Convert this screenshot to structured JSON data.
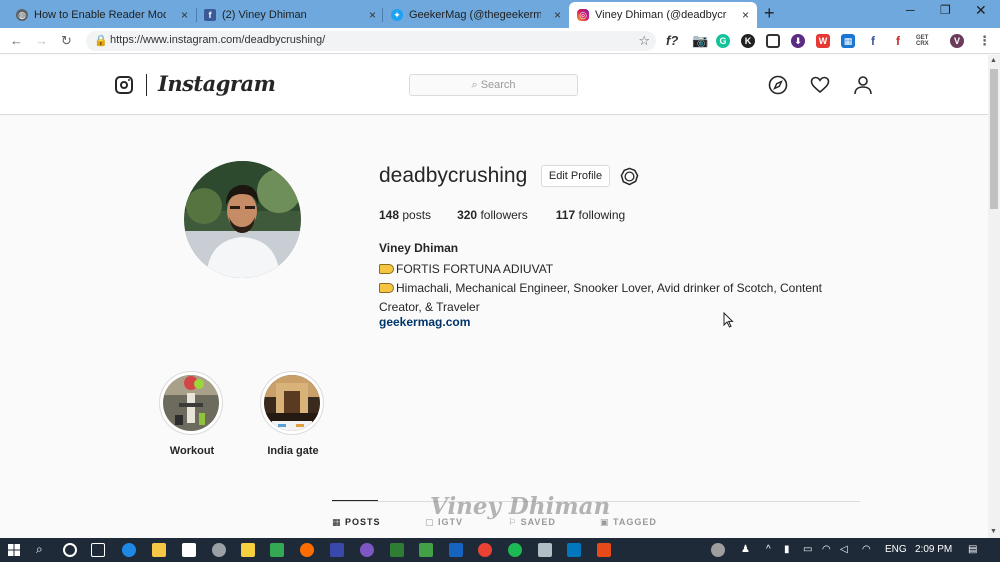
{
  "browser": {
    "tabs": [
      {
        "title": "How to Enable Reader Mode in C",
        "icon": "globe-icon"
      },
      {
        "title": "(2) Viney Dhiman",
        "icon": "facebook-icon"
      },
      {
        "title": "GeekerMag (@thegeekermag) | T",
        "icon": "twitter-icon"
      },
      {
        "title": "Viney Dhiman (@deadbycrushing",
        "icon": "instagram-icon"
      }
    ],
    "close_glyph": "×",
    "new_tab": "+",
    "url": "https://www.instagram.com/deadbycrushing/",
    "ext_f_label": "f?",
    "ext_get_crx": "GET CRX"
  },
  "instagram": {
    "wordmark": "Instagram",
    "search_placeholder": "Search",
    "profile": {
      "username": "deadbycrushing",
      "edit_button": "Edit Profile",
      "posts_count": "148",
      "posts_label": "posts",
      "followers_count": "320",
      "followers_label": "followers",
      "following_count": "117",
      "following_label": "following",
      "full_name": "Viney Dhiman",
      "bio_line1": "FORTIS FORTUNA ADIUVAT",
      "bio_line2": "Himachali, Mechanical Engineer, Snooker Lover, Avid drinker of Scotch, Content Creator, & Traveler",
      "website": "geekermag.com"
    },
    "highlights": [
      {
        "label": "Workout"
      },
      {
        "label": "India gate"
      }
    ],
    "profile_tabs": [
      {
        "label": "POSTS"
      },
      {
        "label": "IGTV"
      },
      {
        "label": "SAVED"
      },
      {
        "label": "TAGGED"
      }
    ],
    "watermark": "Viney Dhiman"
  },
  "taskbar": {
    "language": "ENG",
    "time": "2:09 PM"
  },
  "colors": {
    "chrome_tab_strip": "#6fa8dc",
    "instagram_link": "#003569",
    "taskbar": "#1e2a38"
  }
}
